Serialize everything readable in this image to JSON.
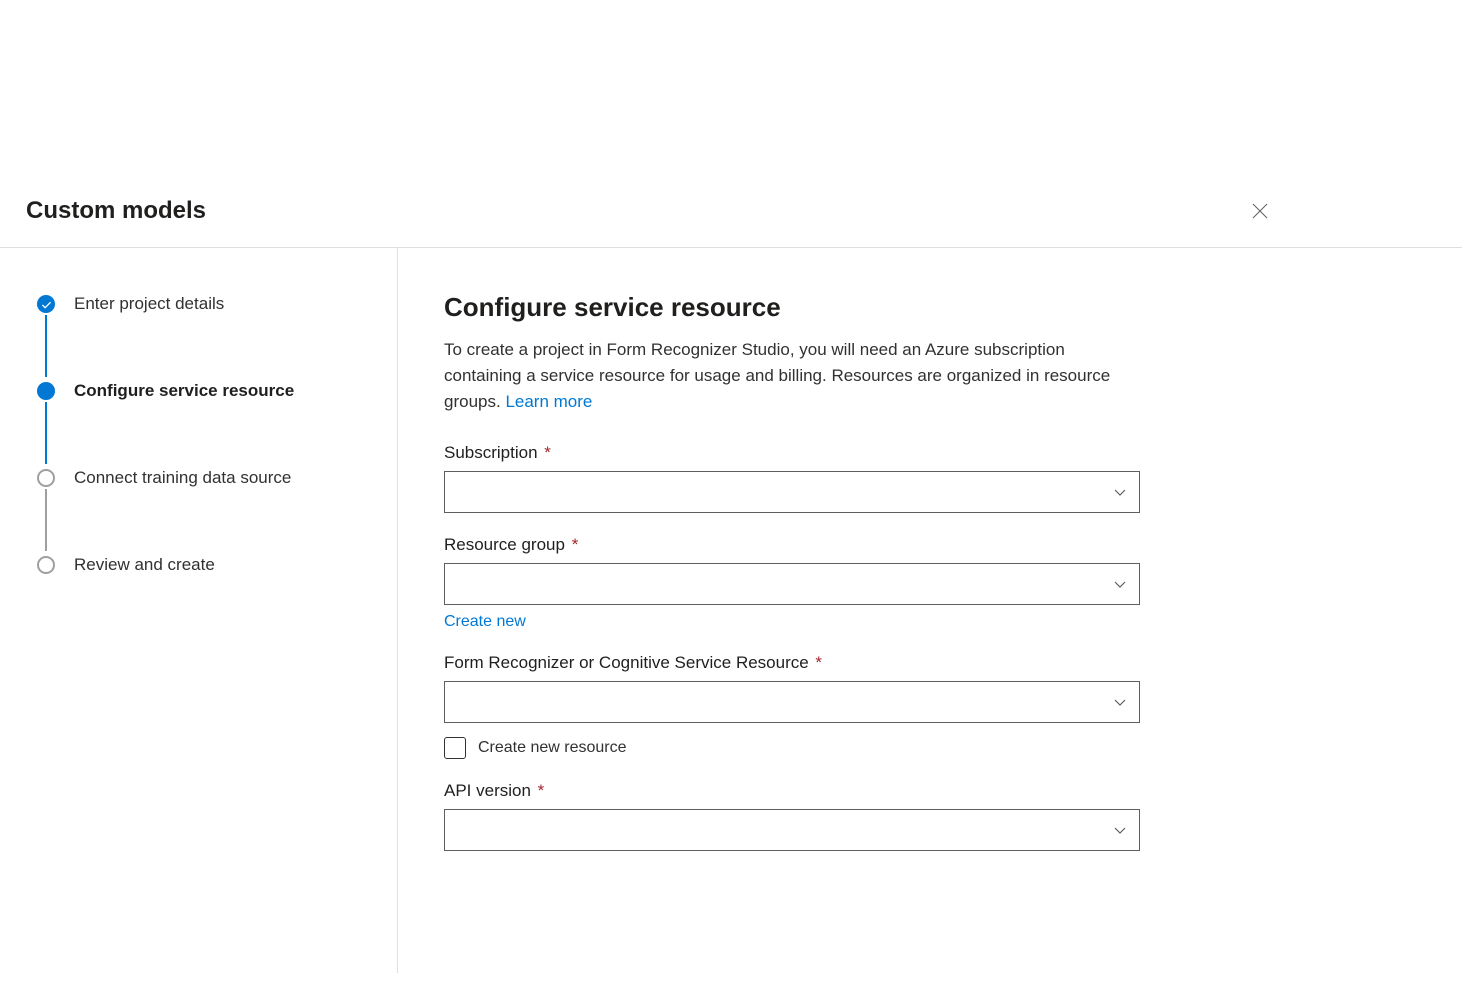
{
  "header": {
    "title": "Custom models"
  },
  "steps": [
    {
      "label": "Enter project details",
      "state": "completed"
    },
    {
      "label": "Configure service resource",
      "state": "active"
    },
    {
      "label": "Connect training data source",
      "state": "inactive"
    },
    {
      "label": "Review and create",
      "state": "inactive"
    }
  ],
  "panel": {
    "heading": "Configure service resource",
    "description_prefix": "To create a project in Form Recognizer Studio, you will need an Azure subscription containing a service resource for usage and billing. Resources are organized in resource groups. ",
    "learn_more": "Learn more"
  },
  "form": {
    "subscription": {
      "label": "Subscription",
      "required": true,
      "value": ""
    },
    "resource_group": {
      "label": "Resource group",
      "required": true,
      "value": "",
      "create_new_label": "Create new"
    },
    "service_resource": {
      "label": "Form Recognizer or Cognitive Service Resource",
      "required": true,
      "value": "",
      "checkbox_label": "Create new resource",
      "checkbox_checked": false
    },
    "api_version": {
      "label": "API version",
      "required": true,
      "value": ""
    }
  }
}
